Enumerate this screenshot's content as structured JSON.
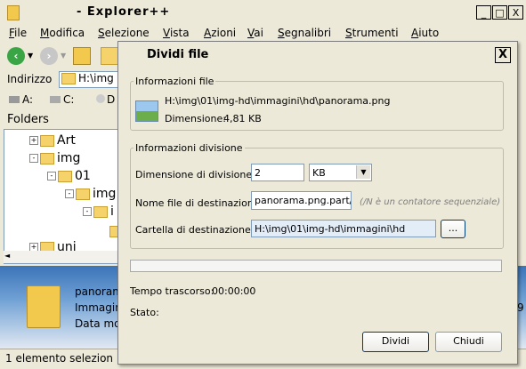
{
  "app": {
    "title": "- Explorer++"
  },
  "window_buttons": {
    "minimize": "_",
    "maximize": "□",
    "close": "X"
  },
  "menu": [
    {
      "label": "File"
    },
    {
      "label": "Modifica"
    },
    {
      "label": "Selezione"
    },
    {
      "label": "Vista"
    },
    {
      "label": "Azioni"
    },
    {
      "label": "Vai"
    },
    {
      "label": "Segnalibri"
    },
    {
      "label": "Strumenti"
    },
    {
      "label": "Aiuto"
    }
  ],
  "address": {
    "label": "Indirizzo",
    "value": "H:\\img"
  },
  "drives": [
    {
      "label": "A:"
    },
    {
      "label": "C:"
    },
    {
      "label": "D"
    }
  ],
  "folders_header": "Folders",
  "tree": [
    {
      "label": "Art"
    },
    {
      "label": "img"
    },
    {
      "label": "01"
    },
    {
      "label": "img"
    },
    {
      "label": "i"
    },
    {
      "label": "uni"
    }
  ],
  "info_pane": {
    "line1": "panoram",
    "line2": "Immagin",
    "line3": "Data mo",
    "right_frag": "9"
  },
  "status": {
    "text": "1 elemento selezion"
  },
  "dialog": {
    "title": "Dividi file",
    "close": "X",
    "file_info": {
      "legend": "Informazioni file",
      "path": "H:\\img\\01\\img-hd\\immagini\\hd\\panorama.png",
      "size_label": "Dimensione:",
      "size_value": "4,81 KB"
    },
    "split_info": {
      "legend": "Informazioni divisione",
      "split_size_label": "Dimensione di divisione:",
      "split_size_value": "2",
      "unit": "KB",
      "dest_name_label": "Nome file di destinazione:",
      "dest_name_value": "panorama.png.part/%",
      "dest_name_hint": "(/N è un contatore sequenziale)",
      "dest_folder_label": "Cartella di destinazione:",
      "dest_folder_value": "H:\\img\\01\\img-hd\\immagini\\hd",
      "browse": "..."
    },
    "progress": 0,
    "elapsed_label": "Tempo trascorso:",
    "elapsed_value": "00:00:00",
    "state_label": "Stato:",
    "split_button": "Dividi",
    "close_button": "Chiudi"
  }
}
